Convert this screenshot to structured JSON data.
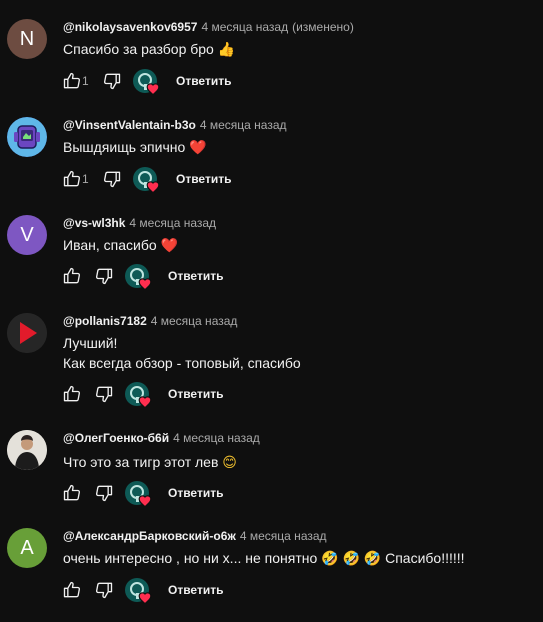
{
  "comments": [
    {
      "author": "@nikolaysavenkov6957",
      "time": "4 месяца назад",
      "edited": "(изменено)",
      "text_lines": [
        "Спасибо за разбор бро"
      ],
      "emoji": "👍",
      "likes": "1",
      "reply_label": "Ответить",
      "avatar": {
        "type": "letter",
        "letter": "N",
        "color": "#6d4c41"
      }
    },
    {
      "author": "@VinsentValentain-b3o",
      "time": "4 месяца назад",
      "edited": "",
      "text_lines": [
        "Вышдяищь эпично"
      ],
      "emoji": "❤️",
      "likes": "1",
      "reply_label": "Ответить",
      "avatar": {
        "type": "image",
        "icon": "purple-device-avatar-icon",
        "color": "#5b3fa8"
      }
    },
    {
      "author": "@vs-wl3hk",
      "time": "4 месяца назад",
      "edited": "",
      "text_lines": [
        "Иван, спасибо"
      ],
      "emoji": "❤️",
      "likes": "",
      "reply_label": "Ответить",
      "avatar": {
        "type": "letter",
        "letter": "V",
        "color": "#7e57c2"
      }
    },
    {
      "author": "@pollanis7182",
      "time": "4 месяца назад",
      "edited": "",
      "text_lines": [
        "Лучший!",
        "Как всегда обзор - топовый, спасибо"
      ],
      "emoji": "",
      "likes": "",
      "reply_label": "Ответить",
      "avatar": {
        "type": "image",
        "icon": "red-play-avatar-icon",
        "color": "#2b2b2b"
      }
    },
    {
      "author": "@ОлегГоенко-б6й",
      "time": "4 месяца назад",
      "edited": "",
      "text_lines": [
        "Что это за тигр этот лев"
      ],
      "emoji": "😊",
      "likes": "",
      "reply_label": "Ответить",
      "avatar": {
        "type": "image",
        "icon": "person-photo-avatar-icon",
        "color": "#d9d6cf"
      }
    },
    {
      "author": "@АлександрБарковский-о6ж",
      "time": "4 месяца назад",
      "edited": "",
      "text_lines": [
        "очень интересно , но ни х... не понятно 🤣 🤣 🤣 Спасибо!!!!!!"
      ],
      "emoji": "",
      "likes": "",
      "reply_label": "Ответить",
      "avatar": {
        "type": "letter",
        "letter": "A",
        "color": "#689f38"
      }
    }
  ]
}
